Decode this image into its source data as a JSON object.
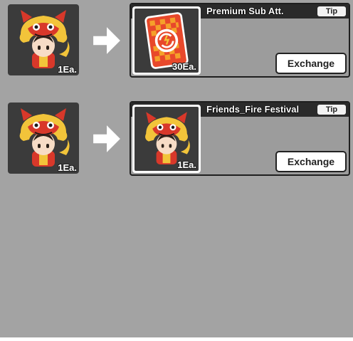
{
  "exchanges": [
    {
      "source": {
        "icon": "lion-dance-character-icon",
        "quantity": "1Ea."
      },
      "target": {
        "title": "Premium Sub Att.",
        "tip_label": "Tip",
        "icon": "premium-sub-att-card-icon",
        "quantity": "30Ea.",
        "exchange_label": "Exchange"
      }
    },
    {
      "source": {
        "icon": "lion-dance-character-icon",
        "quantity": "1Ea."
      },
      "target": {
        "title": "Friends_Fire Festival",
        "tip_label": "Tip",
        "icon": "lion-dance-character-icon",
        "quantity": "1Ea.",
        "exchange_label": "Exchange"
      }
    }
  ],
  "colors": {
    "background": "#a3a3a3",
    "slot": "#3b3b3b",
    "title_band": "#2a2a2a",
    "card_red": "#e8482b",
    "card_orange": "#f5a02a",
    "lion_red": "#d8382a",
    "lion_yellow": "#f2c43a"
  }
}
